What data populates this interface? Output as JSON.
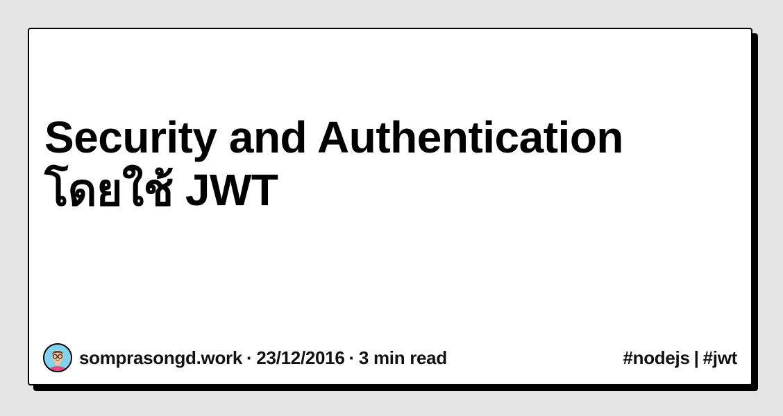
{
  "post": {
    "title_line_1": "Security and Authentication",
    "title_line_2": "โดยใช้ JWT"
  },
  "meta": {
    "author": "somprasongd.work",
    "separator": "·",
    "date": "23/12/2016",
    "read_time": "3 min read"
  },
  "tags": {
    "items": [
      "#nodejs",
      "#jwt"
    ],
    "divider": "|"
  },
  "avatar": {
    "icon": "author-avatar-icon",
    "background": "#7fd3f0",
    "shirt_color": "#e8457c",
    "skin_color": "#f2c59a"
  },
  "colors": {
    "page_background": "#e5e5e5",
    "card_background": "#ffffff",
    "card_border": "#000000",
    "text": "#000000"
  }
}
